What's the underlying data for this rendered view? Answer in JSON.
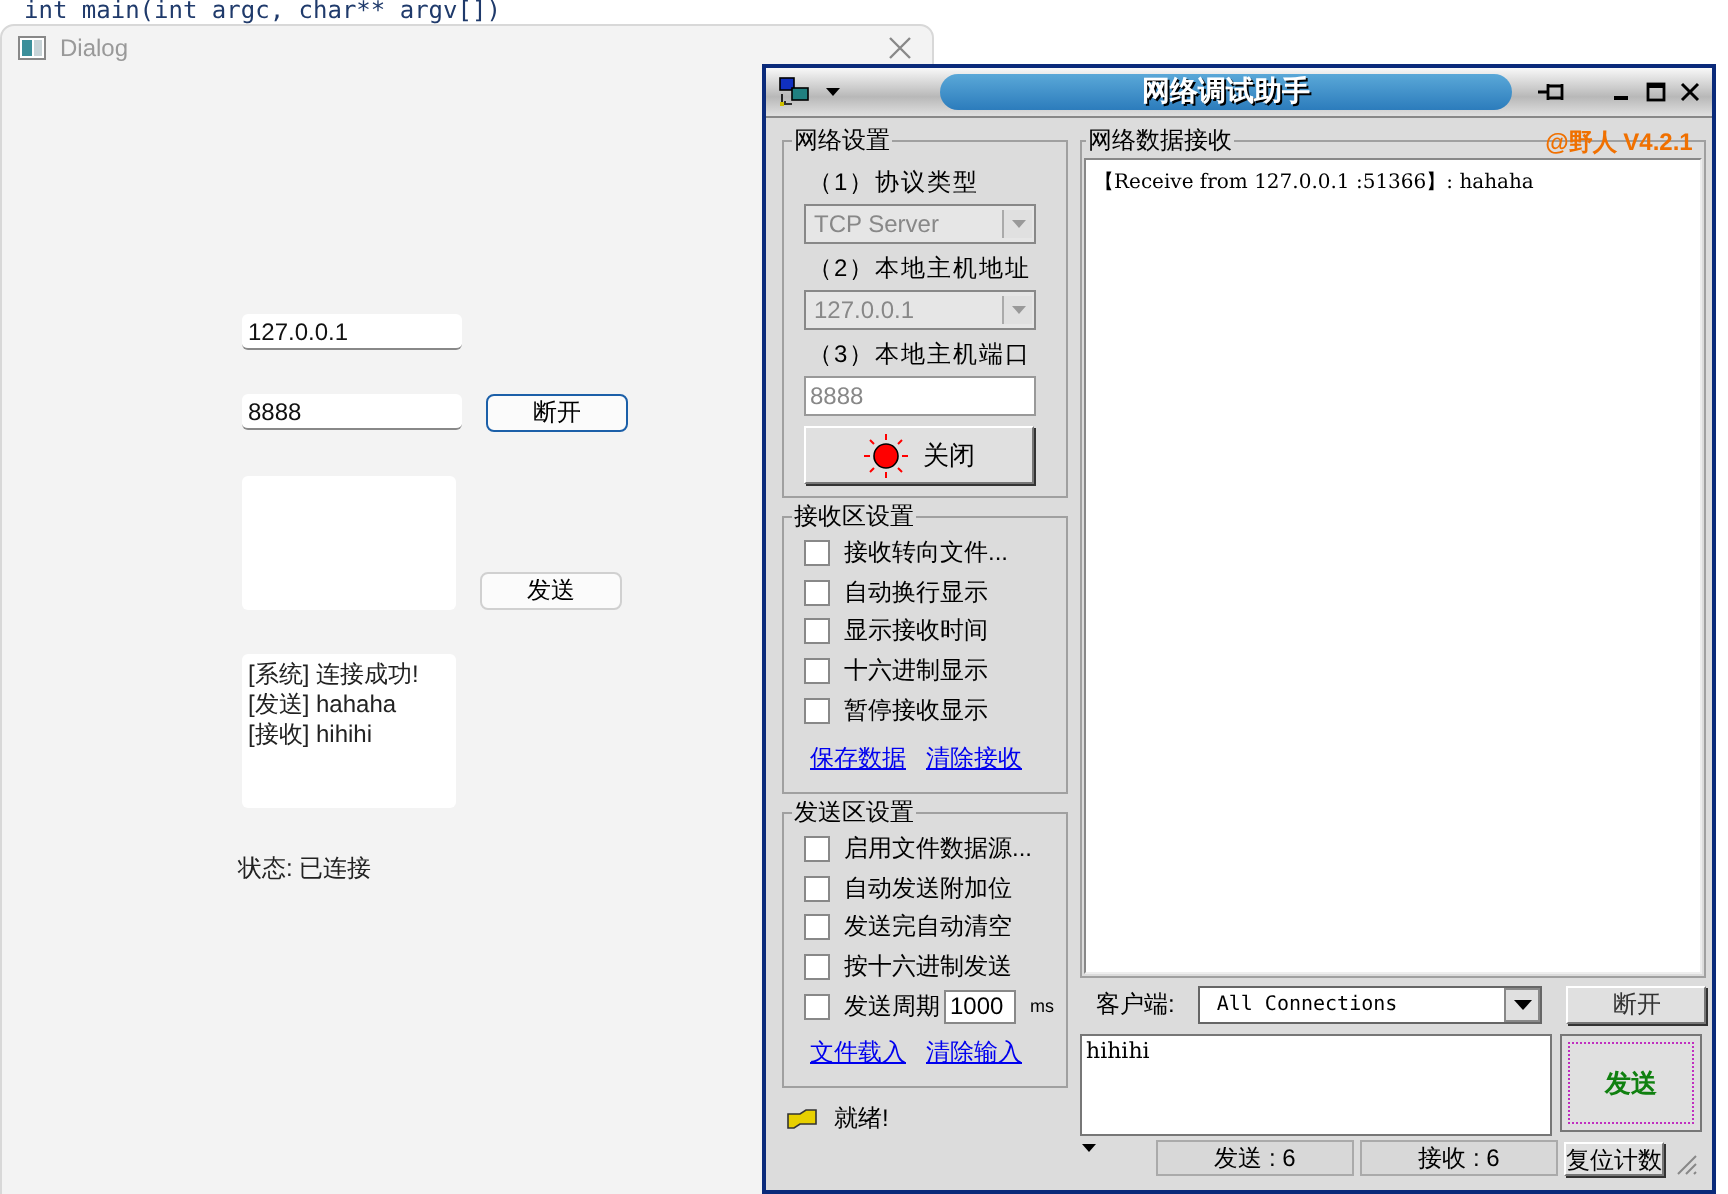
{
  "background_code": "int main(int argc, char** argv[])",
  "dialog": {
    "title": "Dialog",
    "address_field": "127.0.0.1",
    "port_field": "8888",
    "connect_button": "断开",
    "send_button": "发送",
    "log_lines": [
      "[系统] 连接成功!",
      "[发送] hahaha",
      "[接收] hihihi"
    ],
    "status": "状态: 已连接"
  },
  "tool": {
    "title": "网络调试助手",
    "version": "@野人 V4.2.1",
    "network_settings": {
      "title": "网络设置",
      "protocol_label": "（1）协议类型",
      "protocol": {
        "value": "TCP Server",
        "disabled": true
      },
      "address_label": "（2）本地主机地址",
      "address": {
        "value": "127.0.0.1",
        "disabled": true
      },
      "port_label": "（3）本地主机端口",
      "port": {
        "value": "8888",
        "disabled": true
      },
      "close_button": {
        "label": "关闭",
        "on": true
      }
    },
    "receive_settings": {
      "title": "接收区设置",
      "options": [
        {
          "kind": "checkbox",
          "label": "接收转向文件...",
          "checked": false
        },
        {
          "kind": "checkbox",
          "label": "自动换行显示",
          "checked": false
        },
        {
          "kind": "checkbox",
          "label": "显示接收时间",
          "checked": false
        },
        {
          "kind": "checkbox",
          "label": "十六进制显示",
          "checked": false
        },
        {
          "kind": "checkbox",
          "label": "暂停接收显示",
          "checked": false
        }
      ],
      "links": [
        "保存数据",
        "清除接收"
      ]
    },
    "send_settings": {
      "title": "发送区设置",
      "options": [
        {
          "kind": "checkbox",
          "label": "启用文件数据源...",
          "checked": false
        },
        {
          "kind": "checkbox",
          "label": "自动发送附加位",
          "checked": false
        },
        {
          "kind": "checkbox",
          "label": "发送完自动清空",
          "checked": false
        },
        {
          "kind": "checkbox",
          "label": "按十六进制发送",
          "checked": false
        },
        {
          "kind": "period",
          "label": "发送周期",
          "checked": false,
          "value": "1000",
          "unit": "ms"
        }
      ],
      "links": [
        "文件载入",
        "清除输入"
      ]
    },
    "receive_title": "网络数据接收",
    "receive_text": "【Receive from 127.0.0.1 :51366】: hahaha",
    "client_label": "客户端:",
    "client_select": "All Connections",
    "disconnect_button": "断开",
    "send_input": "hihihi",
    "send_button": "发送",
    "status": "就绪!",
    "sent_count": "发送 : 6",
    "received_count": "接收 : 6",
    "reset_button": "复位计数"
  }
}
